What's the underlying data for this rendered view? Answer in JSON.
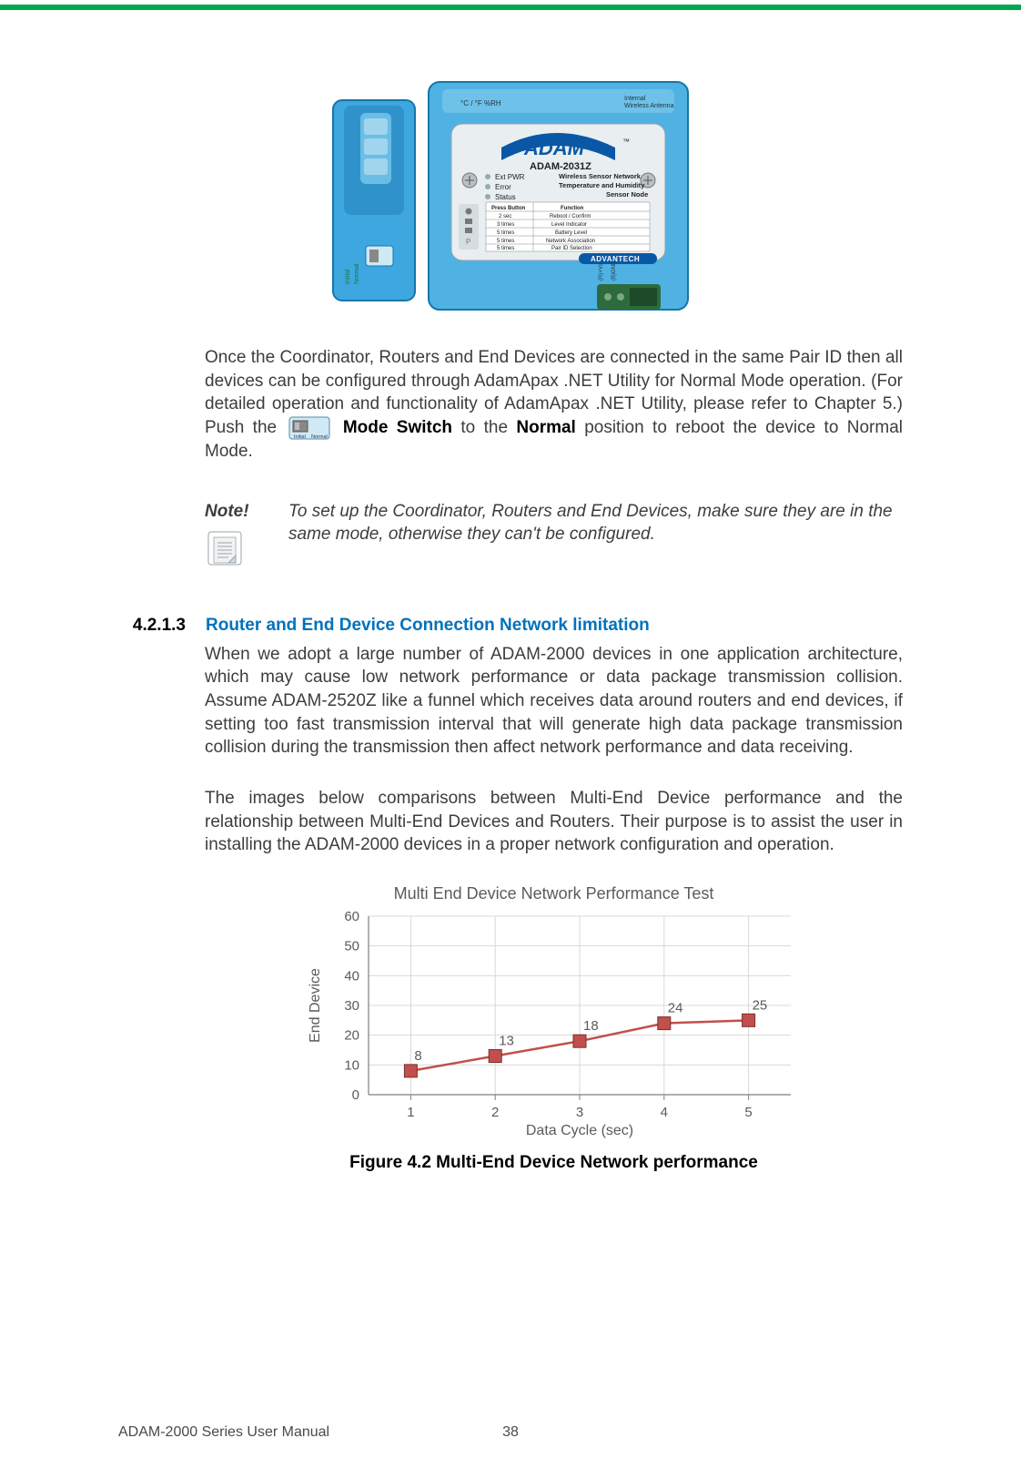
{
  "device": {
    "brand_label": "ADAM",
    "model": "ADAM-2031Z",
    "led_labels": [
      "Ext PWR",
      "Error",
      "Status"
    ],
    "right_header": "Wireless Sensor Network",
    "right_sub": "Temperature and Humidity",
    "right_sub2": "Sensor Node",
    "table_header_left": "Press Button",
    "table_header_right": "Function",
    "table_rows": [
      {
        "l": "2 sec",
        "r": "Reboot / Confirm"
      },
      {
        "l": "3 times",
        "r": "Level Indicator"
      },
      {
        "l": "5 times",
        "r": "Battery Level"
      },
      {
        "l": "5 times",
        "r": "Network Association"
      },
      {
        "l": "5 times",
        "r": "Pair ID Selection"
      }
    ],
    "vendor_label": "ADVANTECH",
    "side_top_chars": "°C / °F   %RH",
    "side_right": "Internal\nWireless\nAntenna",
    "left_side_labels": [
      "Initial",
      "Normal"
    ]
  },
  "paragraph1_a": "Once the Coordinator, Routers and End Devices are connected in the same Pair ID then all devices can be configured through AdamApax .NET Utility for Normal Mode operation. (For detailed operation and functionality of AdamApax .NET Utility, please refer to Chapter 5.) Push the ",
  "paragraph1_b": "Mode Switch",
  "paragraph1_c": " to the ",
  "paragraph1_d": "Normal",
  "paragraph1_e": " position to reboot the device to Normal Mode.",
  "note_label": "Note!",
  "note_text": "To set up the Coordinator, Routers and End Devices, make sure they are in the same mode, otherwise they can't be configured.",
  "section_number": "4.2.1.3",
  "section_title": "Router and End Device Connection Network limitation",
  "paragraph2": "When we adopt a large number of ADAM-2000 devices in one application architecture, which may cause low network performance or data package transmission collision. Assume ADAM-2520Z like a funnel which receives data around routers and end devices, if setting too fast transmission interval that will generate high data package transmission collision during the transmission then affect network performance and data receiving.",
  "paragraph3": "The images below comparisons between Multi-End Device performance and the relationship between Multi-End Devices and Routers. Their purpose is to assist the user in installing the ADAM-2000 devices in a proper network configuration and operation.",
  "chart_title": "Multi End Device Network Performance Test",
  "fig_caption": "Figure 4.2 Multi-End Device Network performance",
  "chart_data": {
    "type": "line",
    "title": "Multi End Device Network Performance Test",
    "xlabel": "Data Cycle (sec)",
    "ylabel": "End Device",
    "x_ticks": [
      1,
      2,
      3,
      4,
      5
    ],
    "y_ticks": [
      0,
      10,
      20,
      30,
      40,
      50,
      60
    ],
    "ylim": [
      0,
      60
    ],
    "categories": [
      1,
      2,
      3,
      4,
      5
    ],
    "values": [
      8,
      13,
      18,
      24,
      25
    ],
    "data_labels": [
      8,
      13,
      18,
      24,
      25
    ],
    "marker": "square",
    "color": "#c0504d"
  },
  "footer_left": "ADAM-2000 Series User Manual",
  "footer_page": "38",
  "inline_switch_labels": {
    "left": "Initial",
    "right": "Normal"
  }
}
